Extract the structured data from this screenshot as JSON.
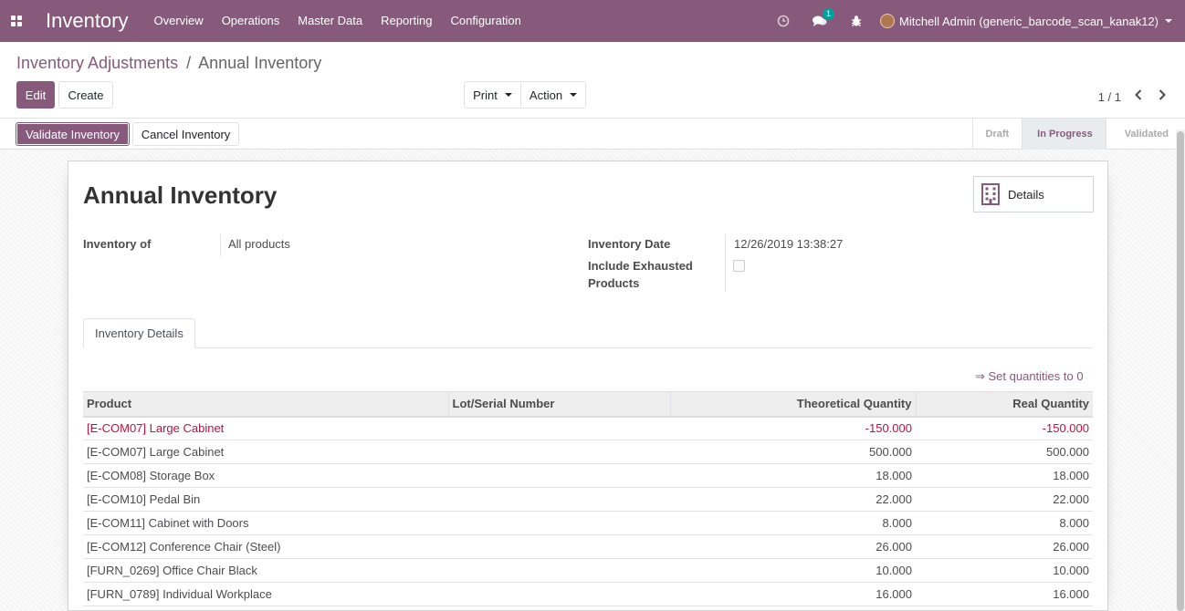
{
  "navbar": {
    "app_name": "Inventory",
    "menu": [
      "Overview",
      "Operations",
      "Master Data",
      "Reporting",
      "Configuration"
    ],
    "messages_badge": "1",
    "user": "Mitchell Admin (generic_barcode_scan_kanak12)"
  },
  "breadcrumb": {
    "parent": "Inventory Adjustments",
    "separator": "/",
    "current": "Annual Inventory"
  },
  "buttons": {
    "edit": "Edit",
    "create": "Create",
    "print": "Print",
    "action": "Action",
    "validate": "Validate Inventory",
    "cancel": "Cancel Inventory",
    "details": "Details",
    "set_quantities": "⇒ Set quantities to 0"
  },
  "pager": {
    "value": "1 / 1"
  },
  "status": [
    "Draft",
    "In Progress",
    "Validated"
  ],
  "status_active": "In Progress",
  "form": {
    "title": "Annual Inventory",
    "inventory_of_label": "Inventory of",
    "inventory_of_value": "All products",
    "inventory_date_label": "Inventory Date",
    "inventory_date_value": "12/26/2019 13:38:27",
    "include_exhausted_label_1": "Include Exhausted",
    "include_exhausted_label_2": "Products",
    "include_exhausted_checked": false
  },
  "tab": {
    "label": "Inventory Details"
  },
  "table": {
    "columns": [
      "Product",
      "Lot/Serial Number",
      "Theoretical Quantity",
      "Real Quantity"
    ],
    "rows": [
      {
        "product": "[E-COM07] Large Cabinet",
        "lot": "",
        "theoretical": "-150.000",
        "real": "-150.000",
        "danger": true
      },
      {
        "product": "[E-COM07] Large Cabinet",
        "lot": "",
        "theoretical": "500.000",
        "real": "500.000",
        "danger": false
      },
      {
        "product": "[E-COM08] Storage Box",
        "lot": "",
        "theoretical": "18.000",
        "real": "18.000",
        "danger": false
      },
      {
        "product": "[E-COM10] Pedal Bin",
        "lot": "",
        "theoretical": "22.000",
        "real": "22.000",
        "danger": false
      },
      {
        "product": "[E-COM11] Cabinet with Doors",
        "lot": "",
        "theoretical": "8.000",
        "real": "8.000",
        "danger": false
      },
      {
        "product": "[E-COM12] Conference Chair (Steel)",
        "lot": "",
        "theoretical": "26.000",
        "real": "26.000",
        "danger": false
      },
      {
        "product": "[FURN_0269] Office Chair Black",
        "lot": "",
        "theoretical": "10.000",
        "real": "10.000",
        "danger": false
      },
      {
        "product": "[FURN_0789] Individual Workplace",
        "lot": "",
        "theoretical": "16.000",
        "real": "16.000",
        "danger": false
      }
    ]
  },
  "colors": {
    "brand": "#875a7b",
    "danger": "#c0103f",
    "badge": "#00a09d"
  }
}
